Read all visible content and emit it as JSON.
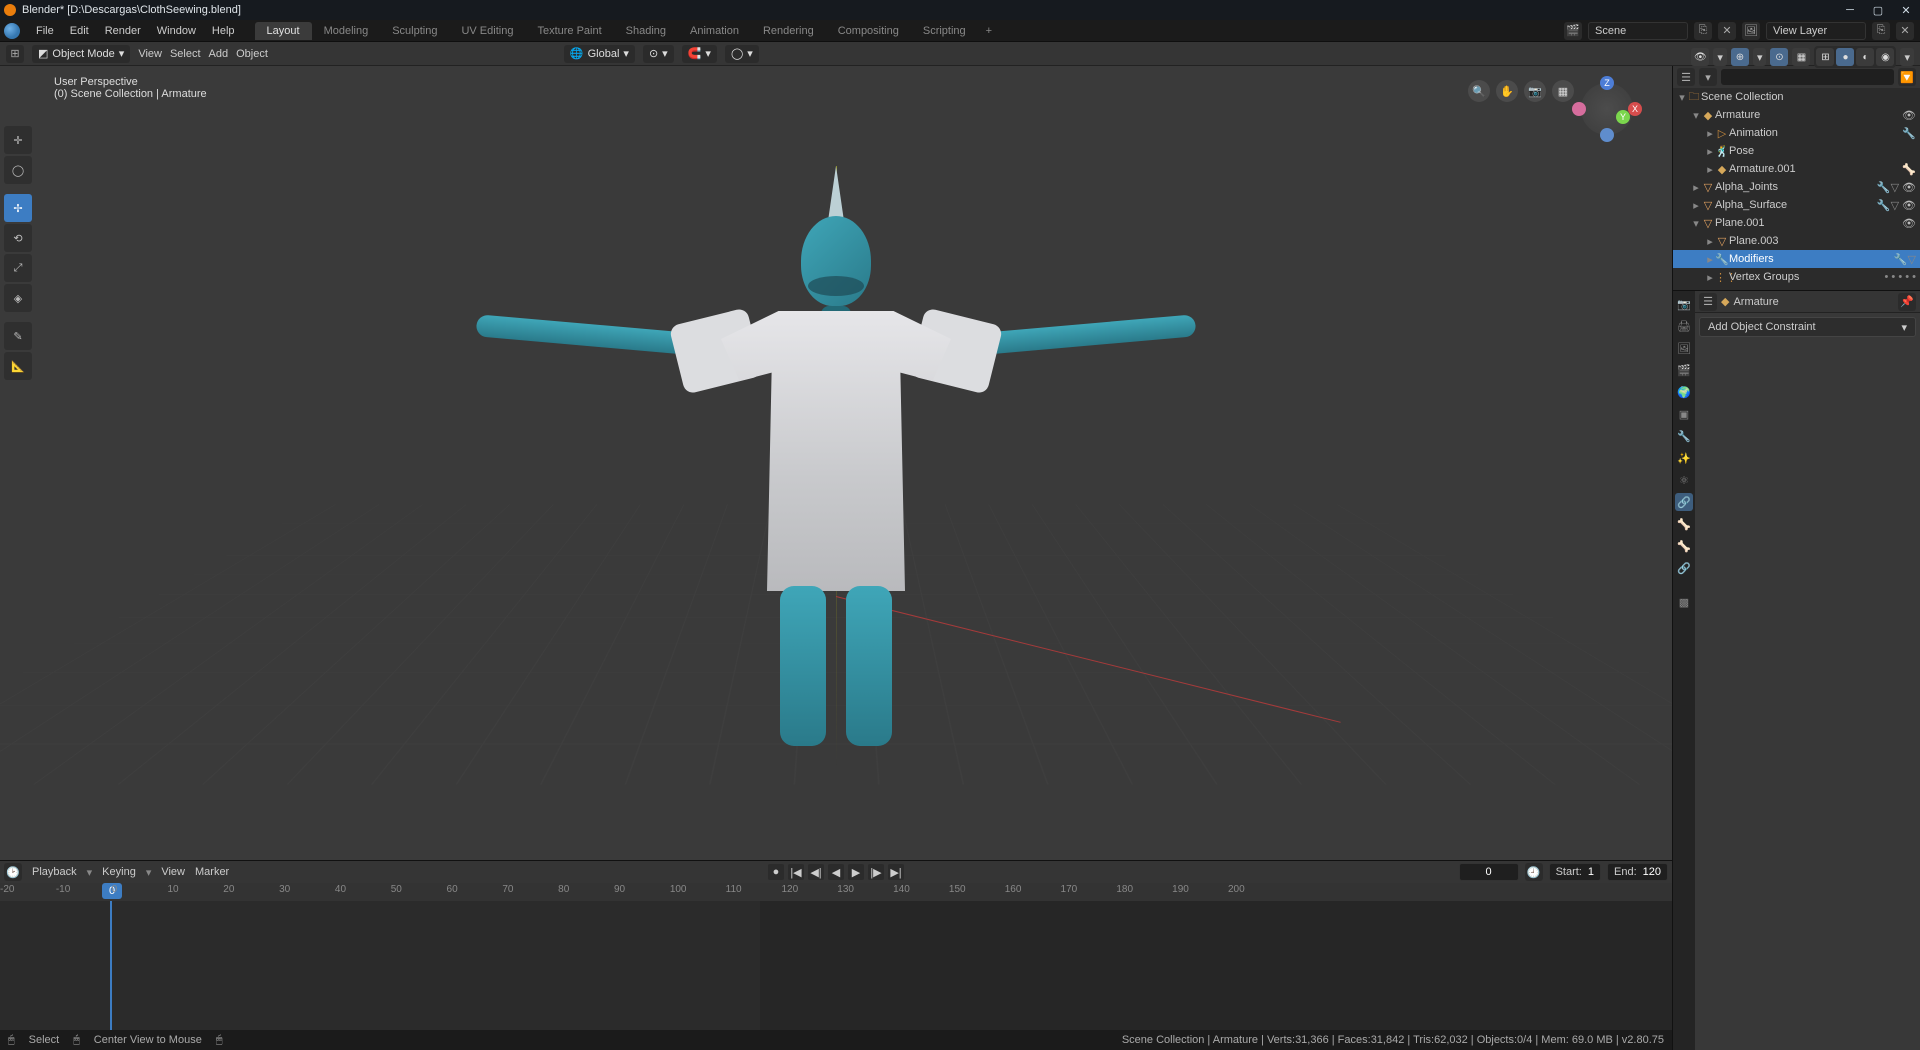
{
  "titlebar": {
    "title": "Blender* [D:\\Descargas\\ClothSeewing.blend]"
  },
  "menubar": {
    "items": [
      "File",
      "Edit",
      "Render",
      "Window",
      "Help"
    ],
    "tabs": [
      "Layout",
      "Modeling",
      "Sculpting",
      "UV Editing",
      "Texture Paint",
      "Shading",
      "Animation",
      "Rendering",
      "Compositing",
      "Scripting"
    ],
    "active_tab": 0,
    "scene_label": "Scene",
    "viewlayer_label": "View Layer"
  },
  "toolbar": {
    "mode": "Object Mode",
    "menus": [
      "View",
      "Select",
      "Add",
      "Object"
    ],
    "orientation": "Global"
  },
  "viewport": {
    "overlay_line1": "User Perspective",
    "overlay_line2": "(0) Scene Collection | Armature",
    "left_tools": [
      "cursor",
      "select",
      "move",
      "rotate",
      "scale",
      "transform",
      "annotate",
      "measure"
    ],
    "active_tool": 2
  },
  "timeline": {
    "menus": [
      "Playback",
      "Keying",
      "View",
      "Marker"
    ],
    "current": "0",
    "start_label": "Start:",
    "start": "1",
    "end_label": "End:",
    "end": "120",
    "ticks": [
      -20,
      -10,
      0,
      10,
      20,
      30,
      40,
      50,
      60,
      70,
      80,
      90,
      100,
      110,
      120,
      130,
      140,
      150,
      160,
      170,
      180,
      190,
      200
    ]
  },
  "status": {
    "left1": "Select",
    "left2": "Center View to Mouse",
    "right": "Scene Collection | Armature | Verts:31,366 | Faces:31,842 | Tris:62,032 | Objects:0/4 | Mem: 69.0 MB | v2.80.75"
  },
  "outliner": {
    "root": "Scene Collection",
    "items": [
      {
        "depth": 1,
        "icon": "ar",
        "label": "Armature",
        "expanded": true,
        "right": [
          "eye"
        ]
      },
      {
        "depth": 2,
        "icon": "an",
        "label": "Animation",
        "right": [
          "mod"
        ]
      },
      {
        "depth": 2,
        "icon": "po",
        "label": "Pose"
      },
      {
        "depth": 2,
        "icon": "ar",
        "label": "Armature.001",
        "right": [
          "bone"
        ]
      },
      {
        "depth": 1,
        "icon": "me",
        "label": "Alpha_Joints",
        "right": [
          "mods",
          "eye"
        ]
      },
      {
        "depth": 1,
        "icon": "me",
        "label": "Alpha_Surface",
        "right": [
          "mods",
          "eye"
        ]
      },
      {
        "depth": 1,
        "icon": "me",
        "label": "Plane.001",
        "expanded": true,
        "right": [
          "eye"
        ]
      },
      {
        "depth": 2,
        "icon": "me",
        "label": "Plane.003"
      },
      {
        "depth": 2,
        "icon": "mod",
        "label": "Modifiers",
        "selected": true,
        "right": [
          "mods"
        ]
      },
      {
        "depth": 2,
        "icon": "vg",
        "label": "Vertex Groups",
        "right": [
          "dots"
        ]
      }
    ]
  },
  "properties": {
    "breadcrumb": "Armature",
    "add_label": "Add Object Constraint",
    "tabs": [
      "render",
      "output",
      "viewlayer",
      "scene",
      "world",
      "object",
      "constraint",
      "modifier",
      "particle",
      "physics",
      "objdata",
      "material",
      "texture"
    ],
    "active_tab": 6
  }
}
